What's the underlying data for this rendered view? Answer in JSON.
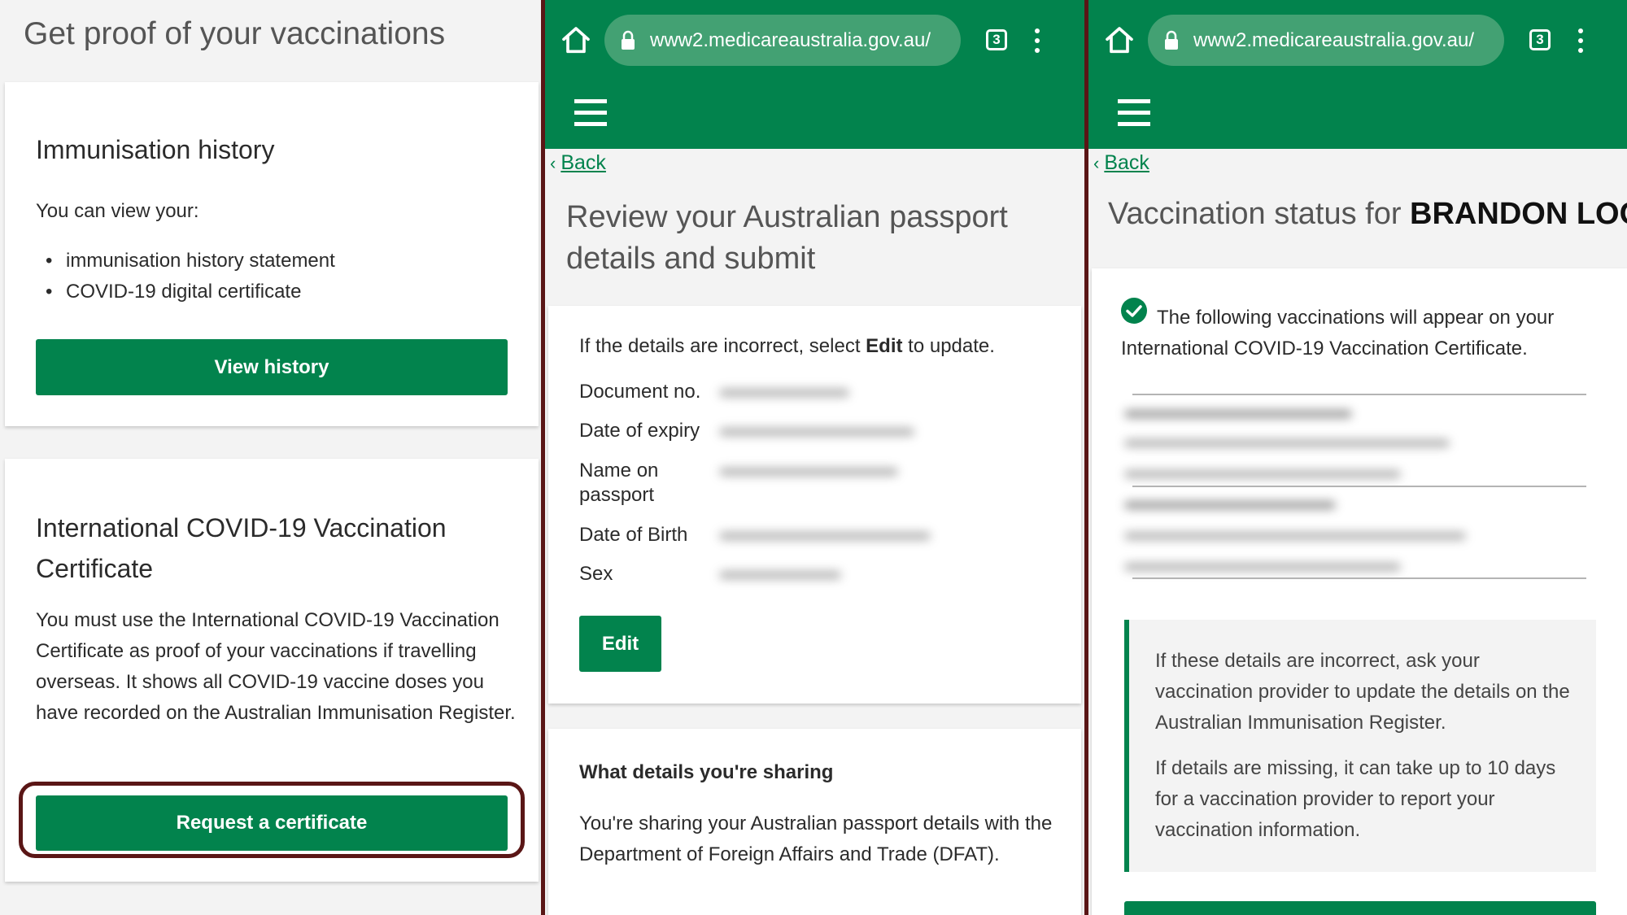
{
  "panel1": {
    "title": "Get proof of your vaccinations",
    "immunisation": {
      "heading": "Immunisation history",
      "intro": "You can view your:",
      "items": [
        "immunisation history statement",
        "COVID-19 digital certificate"
      ],
      "button": "View history"
    },
    "certificate": {
      "heading": "International COVID-19 Vaccination Certificate",
      "body": "You must use the International COVID-19 Vaccination Certificate as proof of your vaccinations if travelling overseas. It shows all COVID-19 vaccine doses you have recorded on the Australian Immunisation Register.",
      "button": "Request a certificate"
    }
  },
  "browser": {
    "url": "www2.medicareaustralia.gov.au/",
    "tab_count": "3"
  },
  "panel2": {
    "back": "Back",
    "heading": "Review your Australian passport details and submit",
    "intro_before": "If the details are incorrect, select ",
    "intro_bold": "Edit",
    "intro_after": " to update.",
    "fields": [
      "Document no.",
      "Date of expiry",
      "Name on passport",
      "Date of Birth",
      "Sex"
    ],
    "edit_button": "Edit",
    "sharing": {
      "heading": "What details you're sharing",
      "body": "You're sharing your Australian passport details with the Department of Foreign Affairs and Trade (DFAT)."
    }
  },
  "panel3": {
    "back": "Back",
    "heading_prefix": "Vaccination status for ",
    "heading_name": "BRANDON LOO",
    "intro": "The following vaccinations will appear on your International COVID-19 Vaccination Certificate.",
    "info": [
      "If these details are incorrect, ask your vaccination provider to update the details on the Australian Immunisation Register.",
      "If details are missing, it can take up to 10 days for a vaccination provider to report your vaccination information."
    ]
  },
  "icons": {
    "home": "home-icon",
    "lock": "lock-icon",
    "tabs": "tabs-icon",
    "menu": "more-vert-icon",
    "hamburger": "hamburger-menu-icon",
    "check": "check-circle-icon",
    "back": "chevron-left-icon"
  },
  "colors": {
    "brand_green": "#02834d",
    "url_bar": "#43a173",
    "highlight": "#5a1616",
    "page_bg": "#f3f3f3"
  }
}
